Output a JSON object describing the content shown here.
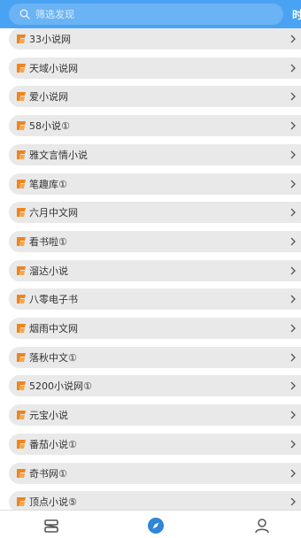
{
  "search": {
    "placeholder": "筛选发现"
  },
  "header": {
    "right_cut_text": "时"
  },
  "colors": {
    "header": "#4aa3f2",
    "item_bg": "#e9e9e9",
    "badge": "#f0841e",
    "active_tab": "#2f86d8",
    "inactive_tab": "#555555"
  },
  "list": {
    "items": [
      "33小说网",
      "天域小说网",
      "爱小说网",
      "58小说①",
      "雅文言情小说",
      "笔趣库①",
      "六月中文网",
      "看书啦①",
      "溜达小说",
      "八零电子书",
      "烟雨中文网",
      "落秋中文①",
      "5200小说网①",
      "元宝小说",
      "番茄小说①",
      "奇书网①",
      "顶点小说⑤"
    ],
    "badge_icon": "book-source-badge-icon",
    "chevron_icon": "chevron-right-icon"
  },
  "tabbar": {
    "tabs": [
      {
        "icon": "bookshelf-icon",
        "active": false
      },
      {
        "icon": "compass-discover-icon",
        "active": true
      },
      {
        "icon": "person-icon",
        "active": false
      }
    ]
  }
}
